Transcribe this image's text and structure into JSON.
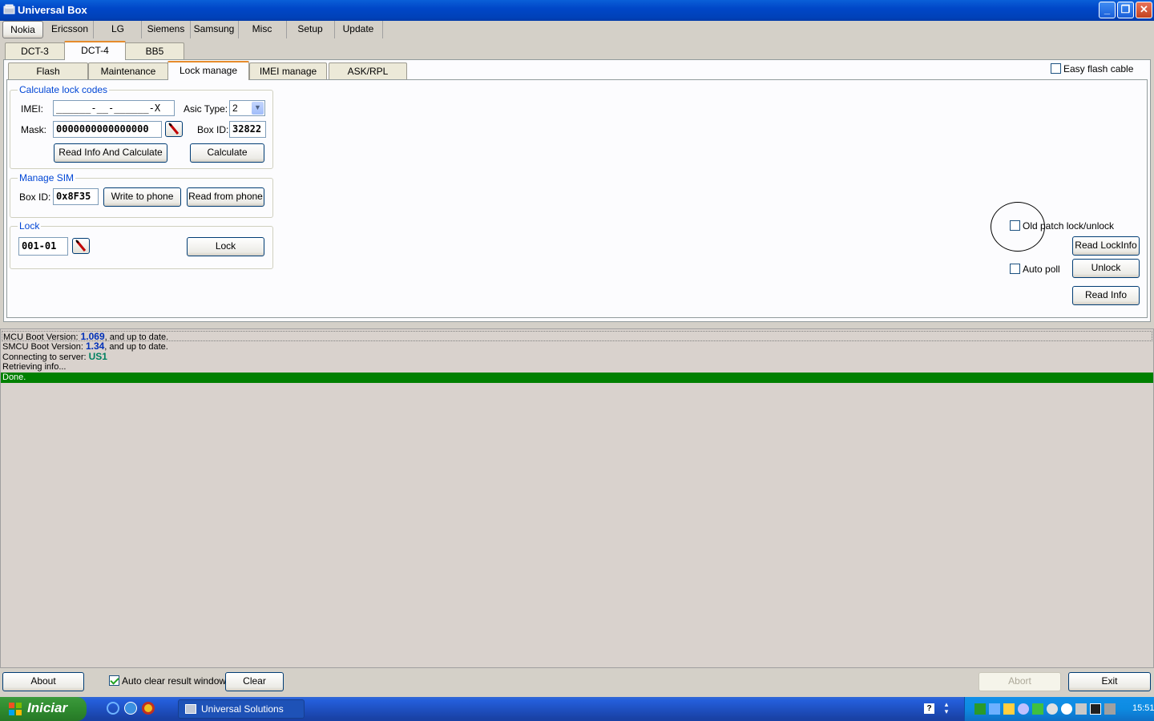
{
  "window": {
    "title": "Universal Box"
  },
  "brand_tabs": [
    "Nokia",
    "Ericsson",
    "LG",
    "Siemens",
    "Samsung",
    "Misc",
    "Setup",
    "Update"
  ],
  "sub_tabs": [
    "DCT-3",
    "DCT-4",
    "BB5"
  ],
  "func_tabs": [
    "Flash",
    "Maintenance",
    "Lock manage",
    "IMEI manage",
    "ASK/RPL manage"
  ],
  "easy_flash": {
    "label": "Easy flash cable",
    "checked": false
  },
  "calc": {
    "title": "Calculate lock codes",
    "imei_label": "IMEI:",
    "imei_value": "______-__-______-X",
    "asic_label": "Asic Type:",
    "asic_value": "2",
    "mask_label": "Mask:",
    "mask_value": "0000000000000000",
    "boxid_label": "Box ID:",
    "boxid_value": "32822",
    "read_calc_btn": "Read Info And Calculate",
    "calc_btn": "Calculate"
  },
  "sim": {
    "title": "Manage SIM",
    "boxid_label": "Box ID:",
    "boxid_value": "0x8F35",
    "write_btn": "Write to phone",
    "read_btn": "Read from phone"
  },
  "lock": {
    "title": "Lock",
    "value": "001-01",
    "lock_btn": "Lock"
  },
  "right_panel": {
    "old_patch_label": "Old patch lock/unlock",
    "old_patch_checked": false,
    "read_lockinfo_btn": "Read LockInfo",
    "auto_poll_label": "Auto poll",
    "auto_poll_checked": false,
    "unlock_btn": "Unlock",
    "read_info_btn": "Read Info"
  },
  "log": {
    "line1_prefix": "MCU Boot Version: ",
    "line1_version": "1.069",
    "line1_suffix": ", and up to date.",
    "line2_prefix": "SMCU Boot Version: ",
    "line2_version": "1.34",
    "line2_suffix": ", and up to date.",
    "line3_prefix": "Connecting to server: ",
    "line3_server": "US1",
    "line4": "Retrieving info...",
    "line5": "Done."
  },
  "bottom": {
    "about_btn": "About",
    "auto_clear_label": "Auto clear result window",
    "auto_clear_checked": true,
    "clear_btn": "Clear",
    "abort_btn": "Abort",
    "exit_btn": "Exit"
  },
  "taskbar": {
    "start_label": "Iniciar",
    "task_label": "Universal Solutions",
    "clock": "15:51"
  },
  "colors": {
    "titlebar": "#0047c8",
    "log_done_bg": "#008000",
    "group_title": "#0046d5"
  }
}
